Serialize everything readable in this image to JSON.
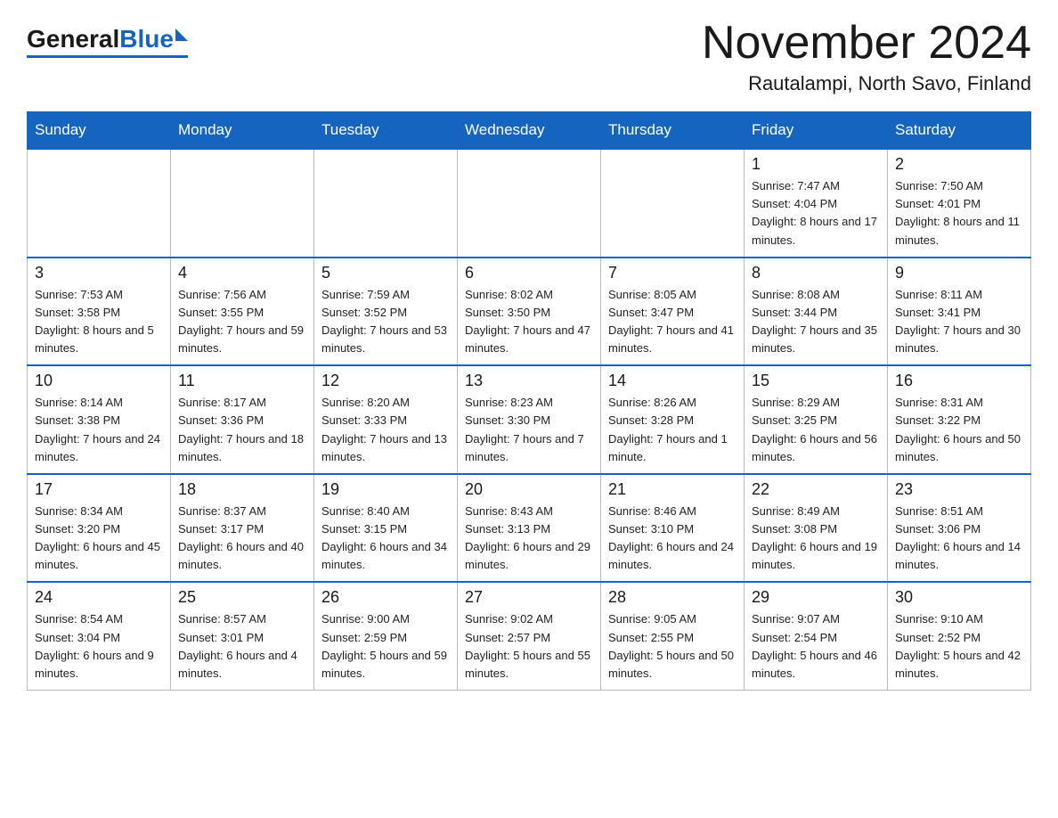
{
  "header": {
    "logo_general": "General",
    "logo_blue": "Blue",
    "title": "November 2024",
    "subtitle": "Rautalampi, North Savo, Finland"
  },
  "days_of_week": [
    "Sunday",
    "Monday",
    "Tuesday",
    "Wednesday",
    "Thursday",
    "Friday",
    "Saturday"
  ],
  "weeks": [
    [
      {
        "day": "",
        "empty": true
      },
      {
        "day": "",
        "empty": true
      },
      {
        "day": "",
        "empty": true
      },
      {
        "day": "",
        "empty": true
      },
      {
        "day": "",
        "empty": true
      },
      {
        "day": "1",
        "sunrise": "7:47 AM",
        "sunset": "4:04 PM",
        "daylight": "8 hours and 17 minutes."
      },
      {
        "day": "2",
        "sunrise": "7:50 AM",
        "sunset": "4:01 PM",
        "daylight": "8 hours and 11 minutes."
      }
    ],
    [
      {
        "day": "3",
        "sunrise": "7:53 AM",
        "sunset": "3:58 PM",
        "daylight": "8 hours and 5 minutes."
      },
      {
        "day": "4",
        "sunrise": "7:56 AM",
        "sunset": "3:55 PM",
        "daylight": "7 hours and 59 minutes."
      },
      {
        "day": "5",
        "sunrise": "7:59 AM",
        "sunset": "3:52 PM",
        "daylight": "7 hours and 53 minutes."
      },
      {
        "day": "6",
        "sunrise": "8:02 AM",
        "sunset": "3:50 PM",
        "daylight": "7 hours and 47 minutes."
      },
      {
        "day": "7",
        "sunrise": "8:05 AM",
        "sunset": "3:47 PM",
        "daylight": "7 hours and 41 minutes."
      },
      {
        "day": "8",
        "sunrise": "8:08 AM",
        "sunset": "3:44 PM",
        "daylight": "7 hours and 35 minutes."
      },
      {
        "day": "9",
        "sunrise": "8:11 AM",
        "sunset": "3:41 PM",
        "daylight": "7 hours and 30 minutes."
      }
    ],
    [
      {
        "day": "10",
        "sunrise": "8:14 AM",
        "sunset": "3:38 PM",
        "daylight": "7 hours and 24 minutes."
      },
      {
        "day": "11",
        "sunrise": "8:17 AM",
        "sunset": "3:36 PM",
        "daylight": "7 hours and 18 minutes."
      },
      {
        "day": "12",
        "sunrise": "8:20 AM",
        "sunset": "3:33 PM",
        "daylight": "7 hours and 13 minutes."
      },
      {
        "day": "13",
        "sunrise": "8:23 AM",
        "sunset": "3:30 PM",
        "daylight": "7 hours and 7 minutes."
      },
      {
        "day": "14",
        "sunrise": "8:26 AM",
        "sunset": "3:28 PM",
        "daylight": "7 hours and 1 minute."
      },
      {
        "day": "15",
        "sunrise": "8:29 AM",
        "sunset": "3:25 PM",
        "daylight": "6 hours and 56 minutes."
      },
      {
        "day": "16",
        "sunrise": "8:31 AM",
        "sunset": "3:22 PM",
        "daylight": "6 hours and 50 minutes."
      }
    ],
    [
      {
        "day": "17",
        "sunrise": "8:34 AM",
        "sunset": "3:20 PM",
        "daylight": "6 hours and 45 minutes."
      },
      {
        "day": "18",
        "sunrise": "8:37 AM",
        "sunset": "3:17 PM",
        "daylight": "6 hours and 40 minutes."
      },
      {
        "day": "19",
        "sunrise": "8:40 AM",
        "sunset": "3:15 PM",
        "daylight": "6 hours and 34 minutes."
      },
      {
        "day": "20",
        "sunrise": "8:43 AM",
        "sunset": "3:13 PM",
        "daylight": "6 hours and 29 minutes."
      },
      {
        "day": "21",
        "sunrise": "8:46 AM",
        "sunset": "3:10 PM",
        "daylight": "6 hours and 24 minutes."
      },
      {
        "day": "22",
        "sunrise": "8:49 AM",
        "sunset": "3:08 PM",
        "daylight": "6 hours and 19 minutes."
      },
      {
        "day": "23",
        "sunrise": "8:51 AM",
        "sunset": "3:06 PM",
        "daylight": "6 hours and 14 minutes."
      }
    ],
    [
      {
        "day": "24",
        "sunrise": "8:54 AM",
        "sunset": "3:04 PM",
        "daylight": "6 hours and 9 minutes."
      },
      {
        "day": "25",
        "sunrise": "8:57 AM",
        "sunset": "3:01 PM",
        "daylight": "6 hours and 4 minutes."
      },
      {
        "day": "26",
        "sunrise": "9:00 AM",
        "sunset": "2:59 PM",
        "daylight": "5 hours and 59 minutes."
      },
      {
        "day": "27",
        "sunrise": "9:02 AM",
        "sunset": "2:57 PM",
        "daylight": "5 hours and 55 minutes."
      },
      {
        "day": "28",
        "sunrise": "9:05 AM",
        "sunset": "2:55 PM",
        "daylight": "5 hours and 50 minutes."
      },
      {
        "day": "29",
        "sunrise": "9:07 AM",
        "sunset": "2:54 PM",
        "daylight": "5 hours and 46 minutes."
      },
      {
        "day": "30",
        "sunrise": "9:10 AM",
        "sunset": "2:52 PM",
        "daylight": "5 hours and 42 minutes."
      }
    ]
  ],
  "labels": {
    "sunrise": "Sunrise:",
    "sunset": "Sunset:",
    "daylight": "Daylight:"
  }
}
